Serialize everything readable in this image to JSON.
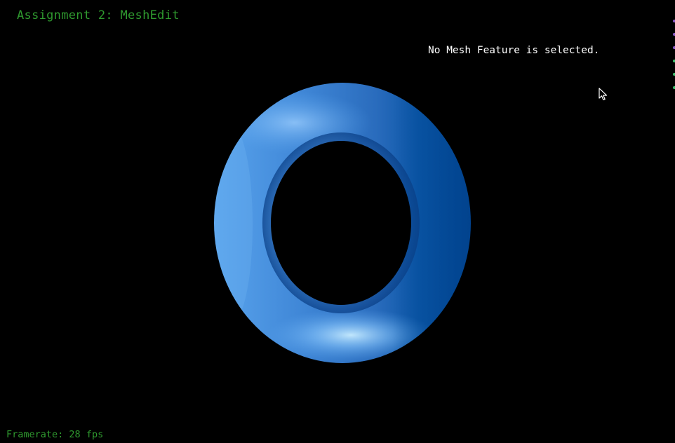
{
  "window": {
    "title": "Assignment 2: MeshEdit"
  },
  "status": {
    "selection_message": "No Mesh Feature is selected."
  },
  "footer": {
    "framerate_label": "Framerate:",
    "framerate_value": "28",
    "framerate_unit": "fps"
  },
  "scene": {
    "object": "torus-mesh",
    "colors": {
      "background": "#000000",
      "mesh_base": "#3a7fd0",
      "mesh_highlight": "#a6dcff",
      "mesh_shadow": "#024a98",
      "title_text": "#2f9a2f",
      "status_text": "#ffffff"
    }
  },
  "edge_markers": {
    "colors": [
      "#8a5cc7",
      "#8a5cc7",
      "#8a5cc7",
      "#3fbf6f",
      "#3fbf6f",
      "#3fbf6f"
    ]
  },
  "cursor": {
    "icon": "arrow-pointer-icon"
  }
}
